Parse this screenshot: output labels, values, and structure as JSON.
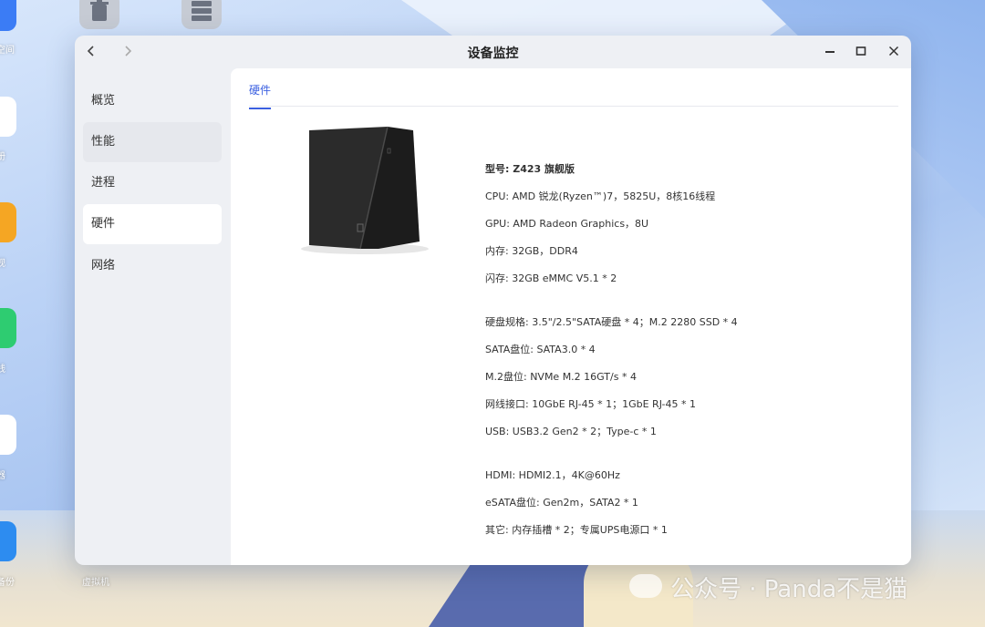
{
  "window": {
    "title": "设备监控",
    "back_icon": "chevron-left-icon",
    "forward_icon": "chevron-right-icon",
    "minimize_icon": "minimize-icon",
    "maximize_icon": "maximize-icon",
    "close_icon": "close-icon"
  },
  "sidebar": {
    "items": [
      {
        "label": "概览"
      },
      {
        "label": "性能"
      },
      {
        "label": "进程"
      },
      {
        "label": "硬件"
      },
      {
        "label": "网络"
      }
    ],
    "active": "硬件"
  },
  "tabs": [
    {
      "label": "硬件"
    }
  ],
  "specs": {
    "group1": [
      "型号: Z423 旗舰版",
      "CPU: AMD 锐龙(Ryzen™)7，5825U，8核16线程",
      "GPU: AMD Radeon Graphics，8U",
      "内存: 32GB，DDR4",
      "闪存: 32GB eMMC V5.1 * 2"
    ],
    "group2": [
      "硬盘规格: 3.5\"/2.5\"SATA硬盘 * 4；M.2 2280 SSD * 4",
      "SATA盘位: SATA3.0 * 4",
      "M.2盘位: NVMe M.2 16GT/s * 4",
      "网线接口: 10GbE RJ-45 * 1；1GbE RJ-45 * 1",
      "USB: USB3.2 Gen2 * 2；Type-c * 1"
    ],
    "group3": [
      "HDMI: HDMI2.1，4K@60Hz",
      "eSATA盘位: Gen2m，SATA2 * 1",
      "其它: 内存插槽 * 2；专属UPS电源口 * 1"
    ]
  },
  "desktop": {
    "left_labels": [
      "空间",
      "册",
      "视",
      "线",
      "器",
      "备份"
    ],
    "bottom_label": "虚拟机",
    "top_icons": [
      "trash-icon",
      "server-icon"
    ]
  },
  "watermark": "公众号 · Panda不是猫",
  "colors": {
    "accent": "#3a5fe0",
    "window_bg": "#eef0f4",
    "content_bg": "#ffffff"
  }
}
